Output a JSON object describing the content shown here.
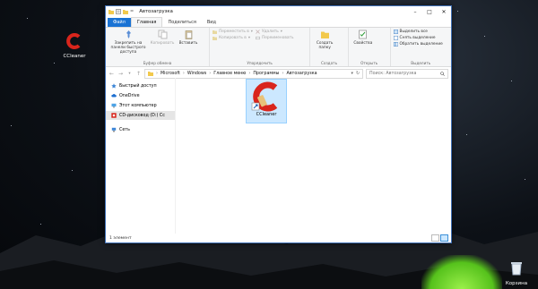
{
  "desktop": {
    "icons": [
      {
        "label": "CCleaner",
        "icon": "ccleaner-icon"
      },
      {
        "label": "Корзина",
        "icon": "recycle-bin-icon"
      }
    ]
  },
  "window": {
    "title": "Автозагрузка",
    "quick_access": {
      "separator": "="
    },
    "tabs": [
      {
        "label": "Файл"
      },
      {
        "label": "Главная"
      },
      {
        "label": "Поделиться"
      },
      {
        "label": "Вид"
      }
    ],
    "ribbon": {
      "clipboard": {
        "pin": "Закрепить на панели быстрого доступа",
        "copy": "Копировать",
        "paste": "Вставить",
        "group": "Буфер обмена"
      },
      "organize": {
        "move_to": "Переместить в",
        "copy_to": "Копировать в",
        "delete": "Удалить",
        "rename": "Переименовать",
        "group": "Упорядочить"
      },
      "create": {
        "new_folder": "Создать папку",
        "group": "Создать"
      },
      "open": {
        "properties": "Свойства",
        "group": "Открыть"
      },
      "select": {
        "select_all": "Выделить все",
        "select_none": "Снять выделение",
        "invert": "Обратить выделение",
        "group": "Выделить"
      }
    },
    "address": {
      "path": [
        "Microsoft",
        "Windows",
        "Главное меню",
        "Программы",
        "Автозагрузка"
      ],
      "search_placeholder": "Поиск: Автозагрузка"
    },
    "nav_pane": [
      {
        "label": "Быстрый доступ",
        "icon": "star-icon"
      },
      {
        "label": "OneDrive",
        "icon": "cloud-icon"
      },
      {
        "label": "Этот компьютер",
        "icon": "computer-icon"
      },
      {
        "label": "CD-дисковод (D:) Cc",
        "icon": "cd-drive-icon"
      },
      {
        "label": "Сеть",
        "icon": "network-icon"
      }
    ],
    "files": [
      {
        "name": "CCleaner",
        "icon": "ccleaner-shortcut-icon"
      }
    ],
    "status": "1 элемент"
  },
  "colors": {
    "accent": "#1a73d4",
    "selection": "#cce8ff",
    "ccleaner_red": "#d9251c"
  }
}
